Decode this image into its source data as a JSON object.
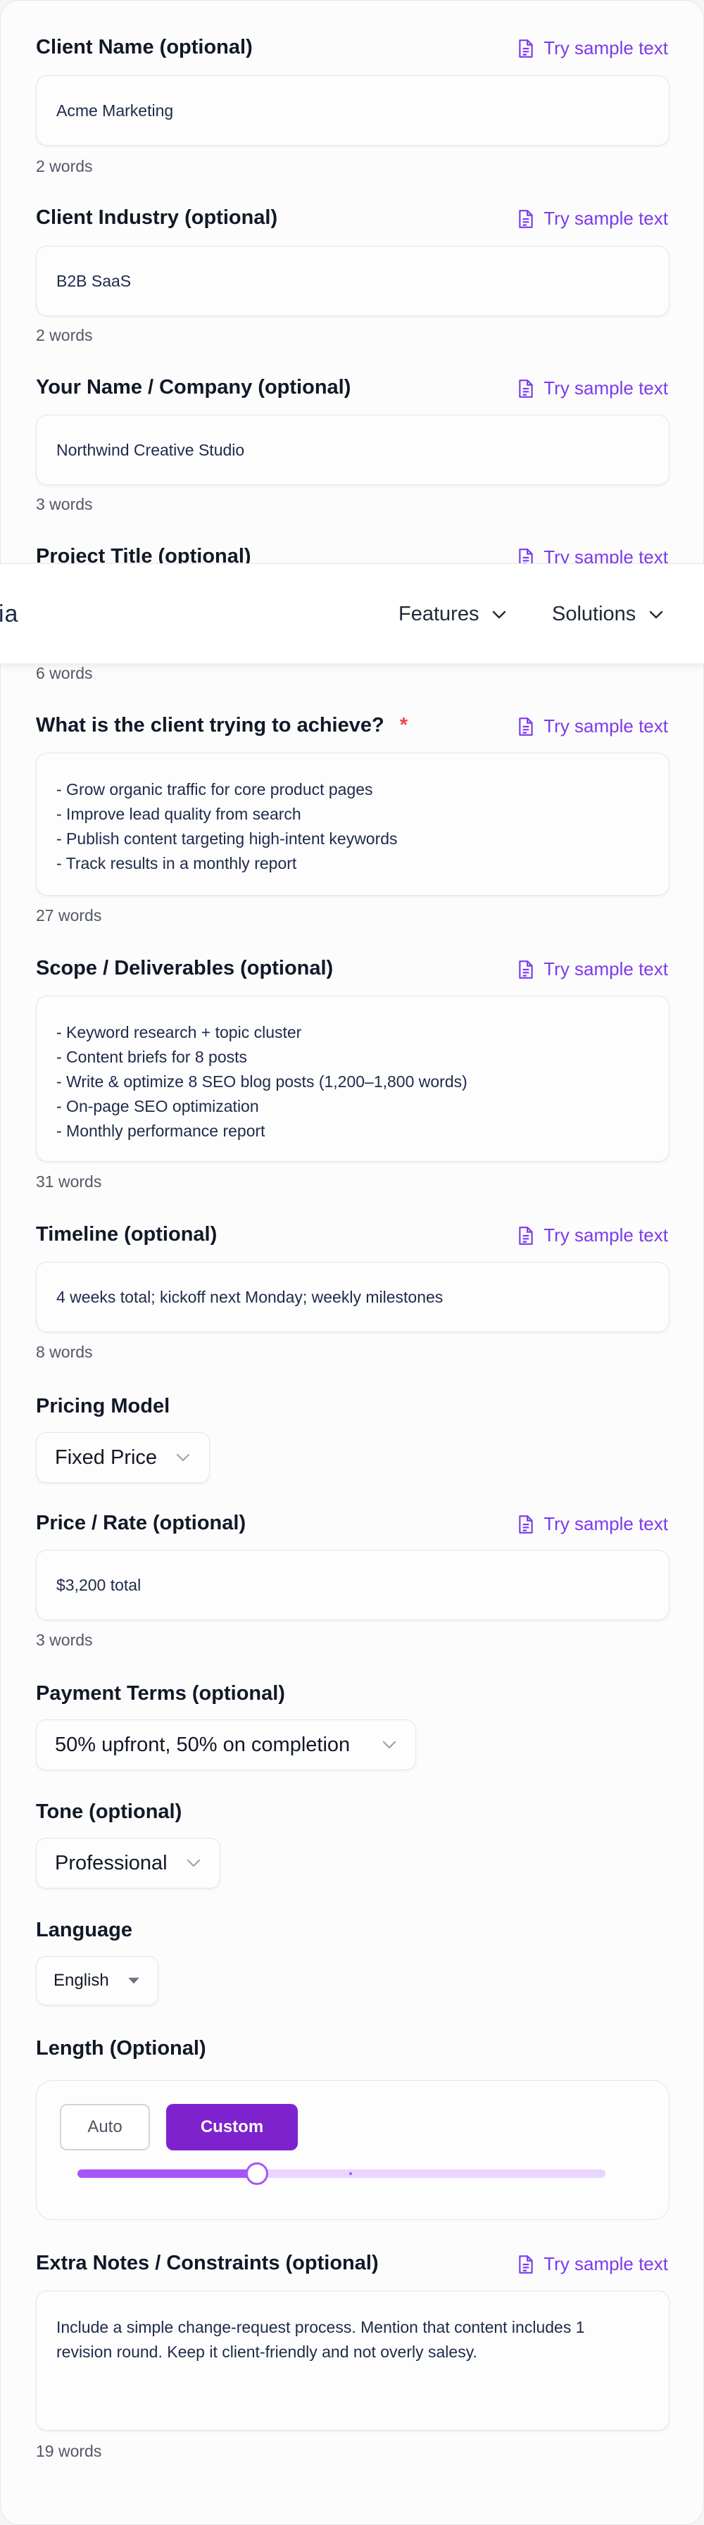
{
  "fields": {
    "client_name": {
      "label": "Client Name (optional)",
      "value": "Acme Marketing",
      "count": "2 words"
    },
    "client_industry": {
      "label": "Client Industry (optional)",
      "value": "B2B SaaS",
      "count": "2 words"
    },
    "your_name": {
      "label": "Your Name / Company (optional)",
      "value": "Northwind Creative Studio",
      "count": "3 words"
    },
    "project_title": {
      "label": "Project Title (optional)",
      "count": "6 words"
    },
    "goal": {
      "label": "What is the client trying to achieve?",
      "required_mark": "*",
      "lines": [
        "- Grow organic traffic for core product pages",
        "- Improve lead quality from search",
        "- Publish content targeting high-intent keywords",
        "- Track results in a monthly report"
      ],
      "count": "27 words"
    },
    "scope": {
      "label": "Scope / Deliverables (optional)",
      "lines": [
        "- Keyword research + topic cluster",
        "- Content briefs for 8 posts",
        "- Write & optimize 8 SEO blog posts (1,200–1,800 words)",
        "- On-page SEO optimization",
        "- Monthly performance report"
      ],
      "count": "31 words"
    },
    "timeline": {
      "label": "Timeline (optional)",
      "value": "4 weeks total; kickoff next Monday; weekly milestones",
      "count": "8 words"
    },
    "pricing_model": {
      "label": "Pricing Model",
      "value": "Fixed Price"
    },
    "price": {
      "label": "Price / Rate (optional)",
      "value": "$3,200 total",
      "count": "3 words"
    },
    "payment_terms": {
      "label": "Payment Terms (optional)",
      "value": "50% upfront, 50% on completion"
    },
    "tone": {
      "label": "Tone (optional)",
      "value": "Professional"
    },
    "language": {
      "label": "Language",
      "value": "English"
    },
    "length": {
      "label": "Length (Optional)",
      "auto_label": "Auto",
      "custom_label": "Custom",
      "selected": "Custom",
      "slider_fraction": 0.34
    },
    "extra_notes": {
      "label": "Extra Notes / Constraints (optional)",
      "lines": [
        "Include a simple change-request process. Mention that content includes 1",
        "revision round. Keep it client-friendly and not overly salesy."
      ],
      "count": "19 words"
    }
  },
  "try_sample_label": "Try sample text",
  "navbar": {
    "logo_fragment": "ia",
    "features": "Features",
    "solutions": "Solutions"
  },
  "colors": {
    "accent": "#7c3aed",
    "accent_button": "#7e22ce",
    "required": "#ef4444",
    "slider_fill": "#a855f7",
    "slider_track": "#e9d5ff"
  },
  "icons": {
    "sample": "document-icon",
    "select": "chevron-down-icon",
    "language": "caret-down-icon"
  }
}
